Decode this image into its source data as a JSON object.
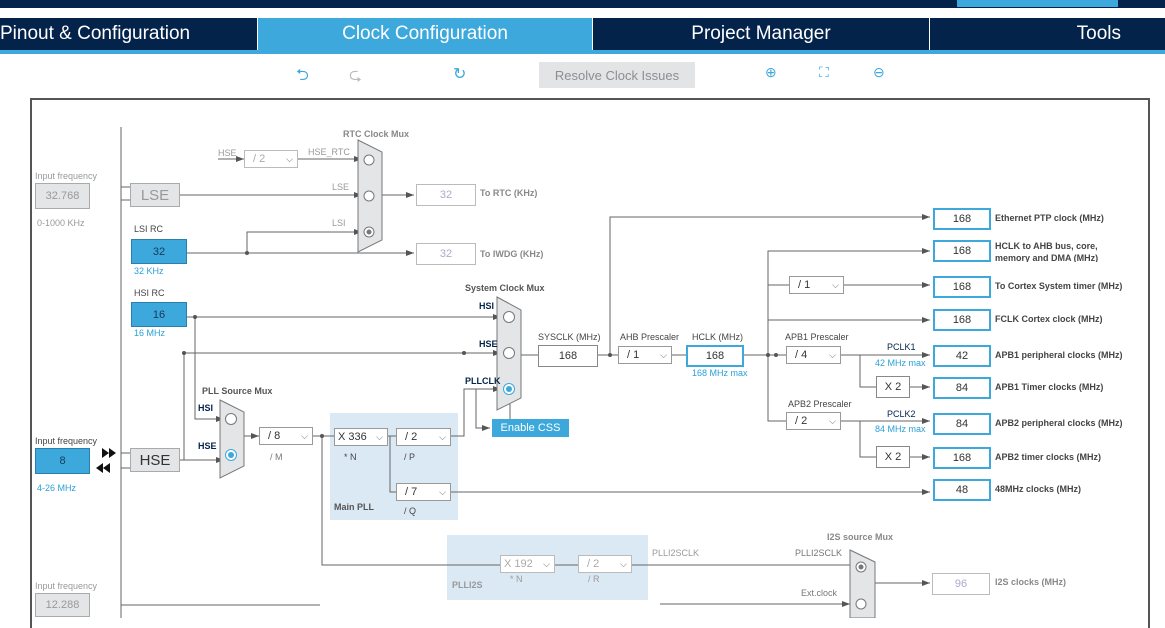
{
  "tabs": [
    "Pinout & Configuration",
    "Clock Configuration",
    "Project Manager",
    "Tools"
  ],
  "active_tab": "Clock Configuration",
  "toolbar": {
    "undo_icon": "undo-icon",
    "redo_icon": "redo-icon",
    "reset_icon": "refresh-icon",
    "resolve": "Resolve Clock Issues",
    "zoom_in_icon": "zoom-in-icon",
    "fit_icon": "fit-screen-icon",
    "zoom_out_icon": "zoom-out-icon"
  },
  "colors": {
    "accent": "#3ca8dc",
    "navy": "#03234b"
  },
  "lse": {
    "input_label": "Input frequency",
    "value": "32.768",
    "range": "0-1000 KHz",
    "name": "LSE"
  },
  "lsi": {
    "title": "LSI RC",
    "value": "32",
    "note": "32 KHz"
  },
  "hsi": {
    "title": "HSI RC",
    "value": "16",
    "note": "16 MHz"
  },
  "hse": {
    "input_label": "Input frequency",
    "value": "8",
    "range": "4-26 MHz",
    "name": "HSE"
  },
  "i2s_ext": {
    "input_label": "Input frequency",
    "value": "12.288"
  },
  "rtc": {
    "title": "RTC Clock Mux",
    "hse": "HSE",
    "div": "/ 2",
    "hse_rtc": "HSE_RTC",
    "lse": "LSE",
    "lsi": "LSI",
    "rtc_value": "32",
    "rtc_label": "To RTC (KHz)",
    "iwdg_value": "32",
    "iwdg_label": "To IWDG (KHz)"
  },
  "sysmux": {
    "title": "System Clock Mux",
    "hsi": "HSI",
    "hse": "HSE",
    "pllclk": "PLLCLK",
    "selected": "PLLCLK",
    "css": "Enable CSS"
  },
  "pllmux": {
    "title": "PLL Source Mux",
    "hsi": "HSI",
    "hse": "HSE",
    "selected": "HSE"
  },
  "pll": {
    "m": "/ 8",
    "m_label": "/ M",
    "n": "X 336",
    "n_label": "* N",
    "p": "/ 2",
    "p_label": "/ P",
    "q": "/ 7",
    "q_label": "/ Q",
    "title": "Main PLL"
  },
  "plli2s": {
    "n": "X 192",
    "n_label": "* N",
    "r": "/ 2",
    "r_label": "/ R",
    "title": "PLLI2S",
    "out": "PLLI2SCLK"
  },
  "i2smux": {
    "title": "I2S source Mux",
    "plli2sclk": "PLLI2SCLK",
    "ext": "Ext.clock",
    "value": "96",
    "label": "I2S clocks (MHz)"
  },
  "sysclk": {
    "label": "SYSCLK (MHz)",
    "value": "168"
  },
  "ahb": {
    "label": "AHB Prescaler",
    "value": "/ 1"
  },
  "hclk": {
    "label": "HCLK (MHz)",
    "value": "168",
    "max": "168 MHz max"
  },
  "cortex_div": "/ 1",
  "apb1": {
    "label": "APB1 Prescaler",
    "value": "/ 4",
    "pclk": "PCLK1",
    "max": "42 MHz max",
    "x2": "X 2"
  },
  "apb2": {
    "label": "APB2 Prescaler",
    "value": "/ 2",
    "pclk": "PCLK2",
    "max": "84 MHz max",
    "x2": "X 2"
  },
  "outputs": [
    {
      "value": "168",
      "label": "Ethernet PTP clock (MHz)"
    },
    {
      "value": "168",
      "label": "HCLK to AHB bus, core, memory and DMA (MHz)"
    },
    {
      "value": "168",
      "label": "To Cortex System timer (MHz)"
    },
    {
      "value": "168",
      "label": "FCLK Cortex clock (MHz)"
    },
    {
      "value": "42",
      "label": "APB1 peripheral clocks (MHz)"
    },
    {
      "value": "84",
      "label": "APB1 Timer clocks (MHz)"
    },
    {
      "value": "84",
      "label": "APB2 peripheral clocks (MHz)"
    },
    {
      "value": "168",
      "label": "APB2 timer clocks (MHz)"
    },
    {
      "value": "48",
      "label": "48MHz clocks (MHz)"
    }
  ]
}
